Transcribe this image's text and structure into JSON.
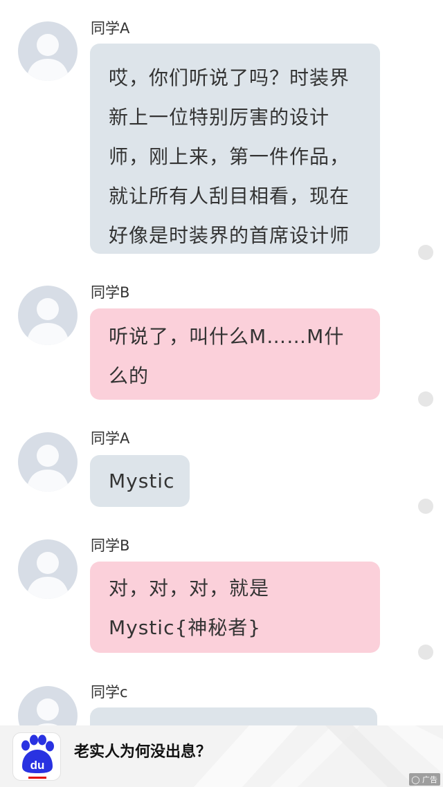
{
  "colors": {
    "gray_bubble": "#dde4ea",
    "pink_bubble": "#fbd0da",
    "avatar_bg": "#d7dde6",
    "baidu_blue": "#2932e1",
    "baidu_red": "#e10602"
  },
  "messages": [
    {
      "sender": "同学A",
      "bubble_color": "gray",
      "lines": [
        "哎，你们听说了吗？时装界",
        "新上一位特别厉害的设计",
        "师，刚上来，第一件作品，",
        "就让所有人刮目相看，现在",
        "好像是时装界的首席设计师"
      ]
    },
    {
      "sender": "同学B",
      "bubble_color": "pink",
      "lines": [
        "听说了，叫什么M……M什",
        "么的"
      ]
    },
    {
      "sender": "同学A",
      "bubble_color": "gray",
      "lines": [
        "Mystic"
      ]
    },
    {
      "sender": "同学B",
      "bubble_color": "pink",
      "lines": [
        "对，对，对，就是",
        "Mystic{神秘者}"
      ]
    },
    {
      "sender": "同学c",
      "bubble_color": "gray",
      "lines": []
    }
  ],
  "ad_banner": {
    "logo_icon": "baidu-paw-icon",
    "logo_text": "du",
    "title": "老实人为何没出息？",
    "tag": "广告"
  }
}
